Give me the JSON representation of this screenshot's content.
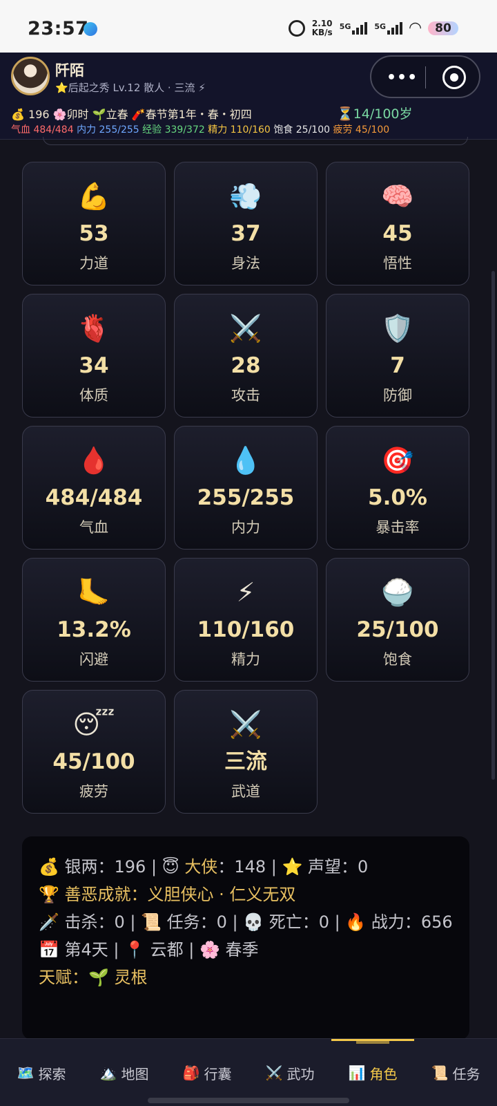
{
  "status_bar": {
    "time": "23:57",
    "speed_value": "2.10",
    "speed_unit": "KB/s",
    "net1": "5G",
    "net2": "5G",
    "battery": "80"
  },
  "header": {
    "name": "阡陌",
    "subtitle": "⭐后起之秀 Lv.12 散人 · 三流 ⚡",
    "info": "💰 196 🌸卯时 🌱立春 🧨春节第1年・春・初四",
    "age": "⏳14/100岁",
    "vitals": {
      "hp": "气血 484/484",
      "mp": "内力 255/255",
      "xp": "经验 339/372",
      "energy": "精力 110/160",
      "food": "饱食 25/100",
      "fatigue": "疲劳 45/100"
    }
  },
  "stats": [
    {
      "icon": "💪",
      "icon_name": "muscle-icon",
      "value": "53",
      "label": "力道"
    },
    {
      "icon": "💨",
      "icon_name": "dash-icon",
      "value": "37",
      "label": "身法"
    },
    {
      "icon": "🧠",
      "icon_name": "brain-icon",
      "value": "45",
      "label": "悟性"
    },
    {
      "icon": "🫀",
      "icon_name": "heart-icon",
      "value": "34",
      "label": "体质"
    },
    {
      "icon": "⚔️",
      "icon_name": "crossed-swords-icon",
      "value": "28",
      "label": "攻击"
    },
    {
      "icon": "🛡️",
      "icon_name": "shield-icon",
      "value": "7",
      "label": "防御"
    },
    {
      "icon": "🩸",
      "icon_name": "blood-drop-icon",
      "value": "484/484",
      "label": "气血"
    },
    {
      "icon": "💧",
      "icon_name": "water-drop-icon",
      "value": "255/255",
      "label": "内力"
    },
    {
      "icon": "🎯",
      "icon_name": "target-icon",
      "value": "5.0%",
      "label": "暴击率"
    },
    {
      "icon": "🦶",
      "icon_name": "foot-icon",
      "value": "13.2%",
      "label": "闪避"
    },
    {
      "icon": "⚡",
      "icon_name": "lightning-icon",
      "value": "110/160",
      "label": "精力"
    },
    {
      "icon": "🍚",
      "icon_name": "rice-icon",
      "value": "25/100",
      "label": "饱食"
    },
    {
      "icon": "😴",
      "icon_name": "sleeping-face-icon",
      "value": "45/100",
      "label": "疲劳"
    },
    {
      "icon": "⚔️",
      "icon_name": "crossed-swords-icon",
      "value": "三流",
      "label": "武道"
    }
  ],
  "summary": {
    "line1_a": "💰 银两：196 | 😇 ",
    "line1_b": "大侠",
    "line1_c": "：148 | ⭐ 声望：0",
    "line2": "🏆 善恶成就：义胆侠心 · 仁义无双",
    "line3": "🗡️ 击杀：0 | 📜 任务：0 | 💀 死亡：0 | 🔥 战力：656",
    "line4": "📅 第4天 | 📍 云都 | 🌸 春季",
    "line5": "天赋：🌱 灵根"
  },
  "tabs": [
    {
      "icon": "🗺️",
      "icon_name": "map-scroll-icon",
      "label": "探索"
    },
    {
      "icon": "🏔️",
      "icon_name": "mountain-icon",
      "label": "地图"
    },
    {
      "icon": "🎒",
      "icon_name": "backpack-icon",
      "label": "行囊"
    },
    {
      "icon": "⚔️",
      "icon_name": "crossed-swords-icon",
      "label": "武功"
    },
    {
      "icon": "📊",
      "icon_name": "bar-chart-icon",
      "label": "角色"
    },
    {
      "icon": "📜",
      "icon_name": "scroll-icon",
      "label": "任务"
    }
  ],
  "active_tab": 4,
  "colors": {
    "accent_gold": "#f3c84a",
    "value_gold": "#f3dfa6",
    "hp_red": "#ff6b6b",
    "mp_blue": "#6fa8ff",
    "xp_green": "#66d77f"
  }
}
